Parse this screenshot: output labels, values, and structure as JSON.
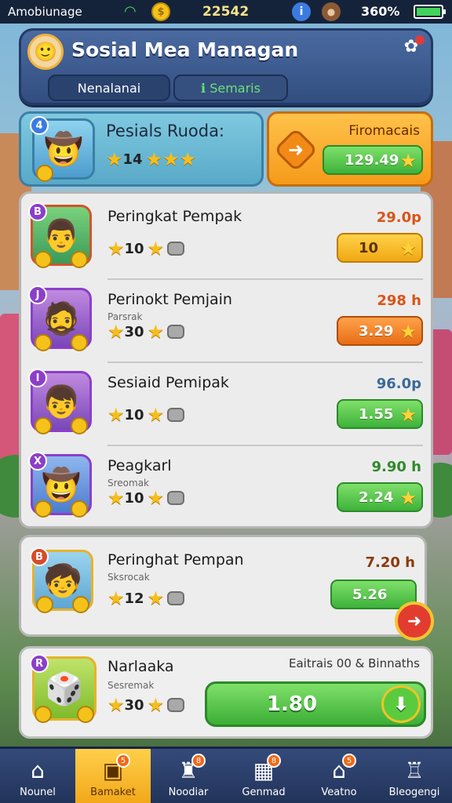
{
  "status_bar": {
    "carrier": "Amobiunage",
    "value": "22542",
    "battery": "360%",
    "battery_level_pct": 100
  },
  "header": {
    "title": "Sosial Mea Managan",
    "tabs": [
      {
        "label": "Nenalanai"
      },
      {
        "label": "Semaris",
        "prefix": "ℹ"
      }
    ]
  },
  "highlight": {
    "title": "Pesials Ruoda:",
    "stars_value": "14",
    "right_title": "Firomacais",
    "button_value": "129.49"
  },
  "rows": [
    {
      "name": "Peringkat Pempak",
      "sub": "",
      "stars_value": "10",
      "price": "29.0p",
      "price_color": "#d9541a",
      "button": "10",
      "button_style": "btn-yellow",
      "badge": "B"
    },
    {
      "name": "Perinokt Pemjain",
      "sub": "Parsrak",
      "stars_value": "30",
      "price": "298 h",
      "price_color": "#d9541a",
      "button": "3.29",
      "button_style": "btn-orange",
      "badge": "J"
    },
    {
      "name": "Sesiaid Pemipak",
      "sub": "",
      "stars_value": "10",
      "price": "96.0p",
      "price_color": "#3a6a9a",
      "button": "1.55",
      "button_style": "btn-green",
      "badge": "I"
    },
    {
      "name": "Peagkarl",
      "sub": "Sreomak",
      "stars_value": "10",
      "price": "9.90 h",
      "price_color": "#2f8a2a",
      "button": "2.24",
      "button_style": "btn-green",
      "badge": "X"
    }
  ],
  "featured": {
    "name": "Peringhat Pempan",
    "sub": "Sksrocak",
    "stars_value": "12",
    "price": "7.20 h",
    "button": "5.26",
    "badge": "B"
  },
  "bottom_card": {
    "name": "Narlaaka",
    "sub": "Sesremak",
    "stars_value": "30",
    "caption": "Eaitrais 00 & Binnaths",
    "button": "1.80",
    "badge": "R"
  },
  "nav": [
    {
      "label": "Nounel",
      "icon": "home-icon",
      "badge": ""
    },
    {
      "label": "Bamaket",
      "icon": "chest-icon",
      "badge": "5",
      "active": true
    },
    {
      "label": "Noodiar",
      "icon": "castle-icon",
      "badge": "8"
    },
    {
      "label": "Genmad",
      "icon": "box-icon",
      "badge": "8"
    },
    {
      "label": "Veatno",
      "icon": "house-icon",
      "badge": "5"
    },
    {
      "label": "Bleogengi",
      "icon": "shop-icon",
      "badge": ""
    }
  ]
}
